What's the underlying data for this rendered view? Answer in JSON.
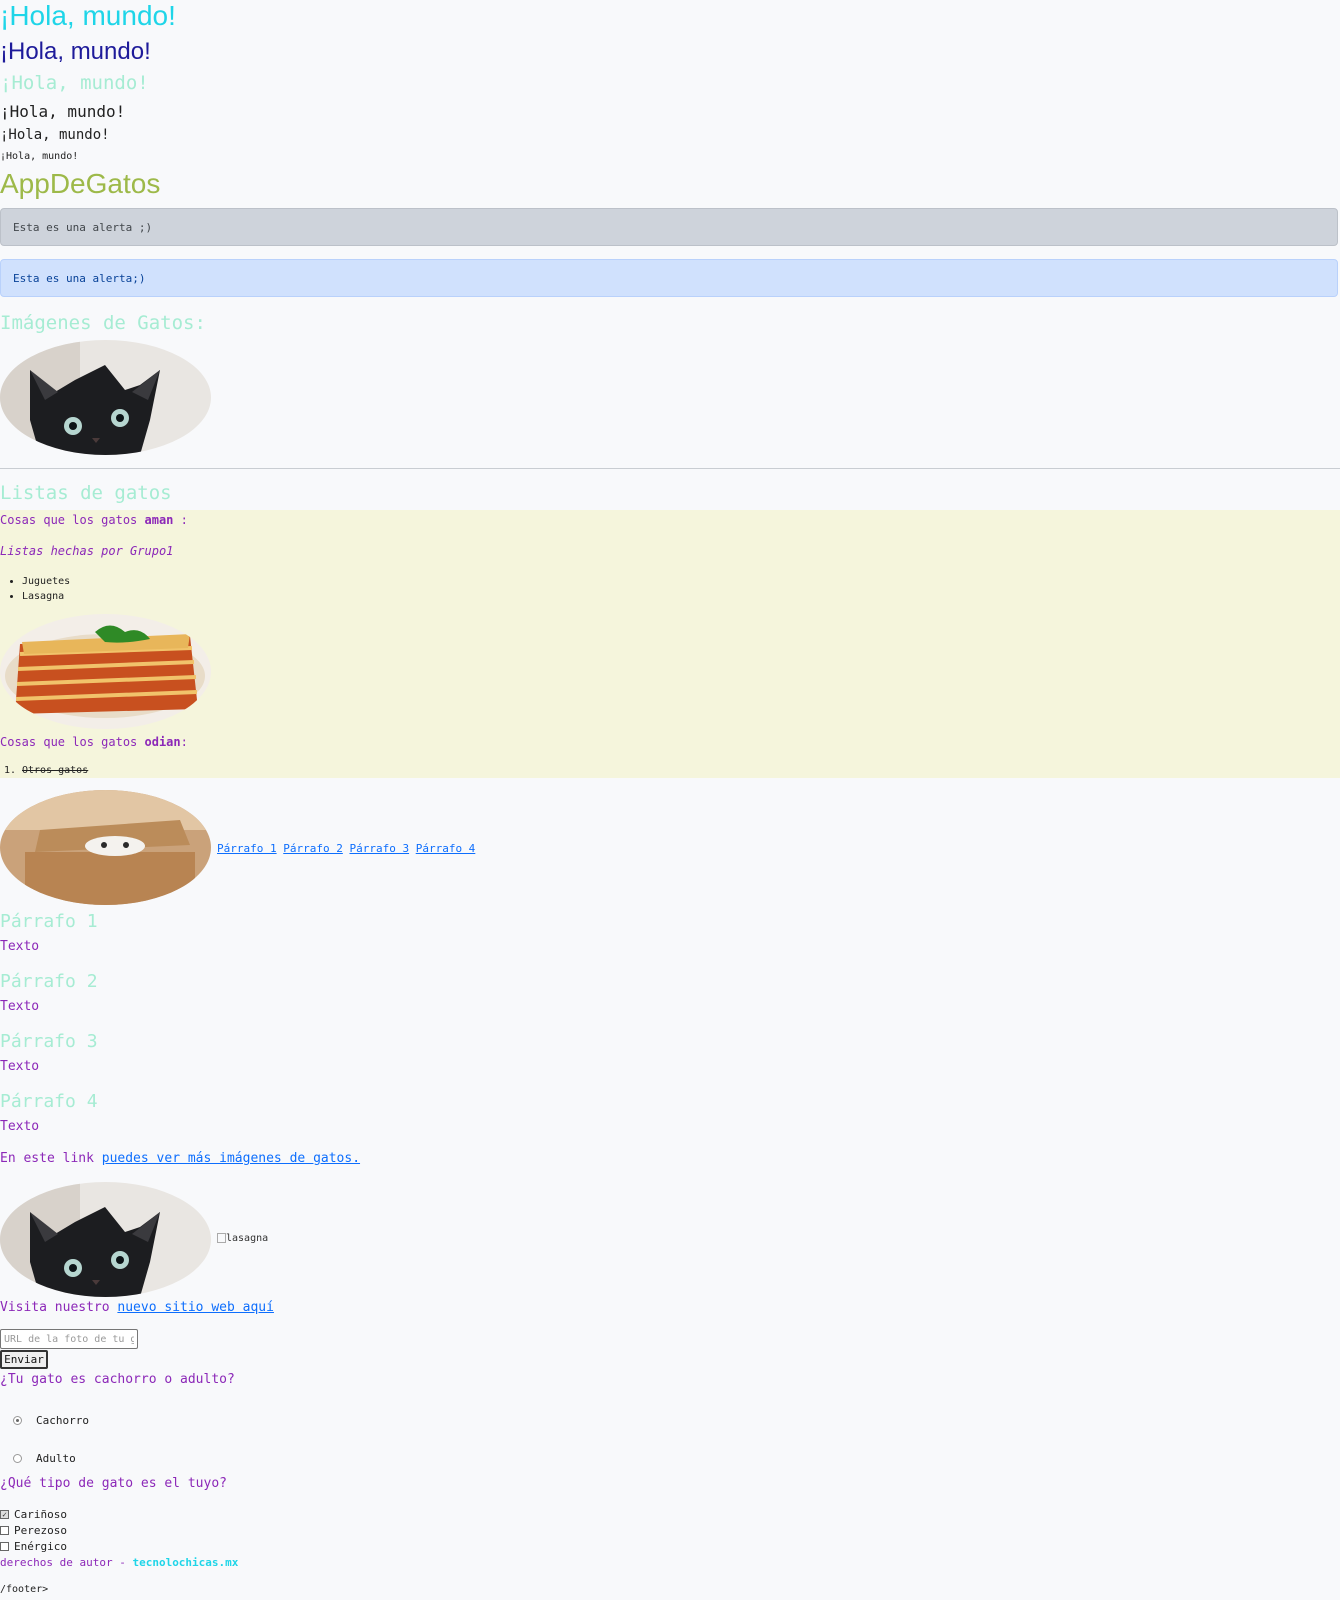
{
  "headings": {
    "h1": "¡Hola, mundo!",
    "h2": "¡Hola, mundo!",
    "h3": "¡Hola, mundo!",
    "h4": "¡Hola, mundo!",
    "h5": "¡Hola, mundo!",
    "h6": "¡Hola, mundo!"
  },
  "brand": "AppDeGatos",
  "alerts": {
    "secondary": "Esta es una alerta ;)",
    "primary": "Esta es una alerta;)"
  },
  "images_section": {
    "title": "Imágenes de Gatos:"
  },
  "lists_section": {
    "title": "Listas de gatos",
    "love_prefix": "Cosas que los gatos ",
    "love_bold": "aman",
    "love_suffix": " :",
    "credit": "Listas hechas por Grupo1",
    "love_items": [
      "Juguetes",
      "Lasagna"
    ],
    "hate_prefix": "Cosas que los gatos ",
    "hate_bold": "odian",
    "hate_suffix": ":",
    "hate_items": [
      "Otros gatos"
    ]
  },
  "anchor_links": [
    "Párrafo 1",
    "Párrafo 2",
    "Párrafo 3",
    "Párrafo 4"
  ],
  "paragraphs": [
    {
      "title": "Párrafo 1",
      "text": "Texto"
    },
    {
      "title": "Párrafo 2",
      "text": "Texto"
    },
    {
      "title": "Párrafo 3",
      "text": "Texto"
    },
    {
      "title": "Párrafo 4",
      "text": "Texto"
    }
  ],
  "more_link": {
    "prefix": "En este link ",
    "link": "puedes ver más imágenes de gatos."
  },
  "broken_image_alt": "lasagna",
  "visit": {
    "prefix": "Visita nuestro ",
    "link": "nuevo sitio web aquí"
  },
  "form": {
    "url_placeholder": "URL de la foto de tu gato",
    "submit": "Enviar",
    "age_question": "¿Tu gato es cachorro o adulto?",
    "age_options": [
      "Cachorro",
      "Adulto"
    ],
    "age_selected": "Cachorro",
    "type_question": "¿Qué tipo de gato es el tuyo?",
    "type_options": [
      "Cariñoso",
      "Perezoso",
      "Enérgico"
    ],
    "type_checked": [
      "Cariñoso"
    ]
  },
  "footer": {
    "text": "derechos de autor - ",
    "brand": "tecnolochicas.mx",
    "stray": "/footer>"
  },
  "colors": {
    "h1": "#1fd5e8",
    "h2": "#1e1b9a",
    "teal": "#a6ecd3",
    "brand": "#9db949",
    "purple": "#8c28b8",
    "beige": "#f5f5dc",
    "link": "#0d6efd"
  }
}
